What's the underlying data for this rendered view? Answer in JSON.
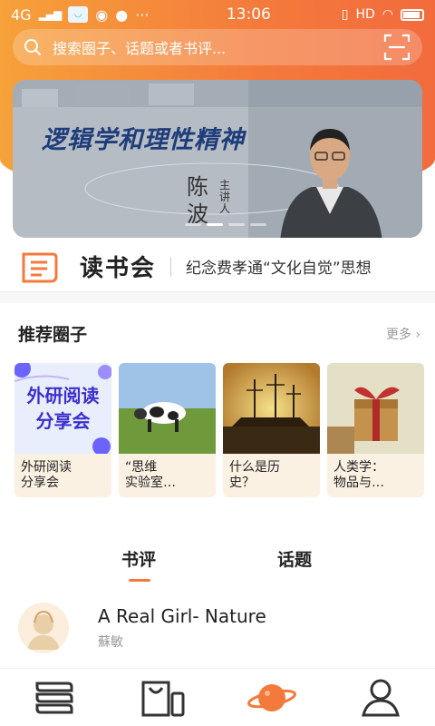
{
  "status": {
    "network": "4G",
    "time": "13:06",
    "hd": "HD"
  },
  "search": {
    "placeholder": "搜索圈子、话题或者书评..."
  },
  "banner": {
    "title": "逻辑学和理性精神",
    "name_line1": "陈",
    "name_line2": "波",
    "role": "主讲人"
  },
  "bookclub": {
    "name": "读书会",
    "headline": "纪念费孝通“文化自觉”思想"
  },
  "recommended": {
    "title": "推荐圈子",
    "more": "更多",
    "cards": [
      {
        "label_line1": "外研阅读",
        "label_line2": "分享会",
        "image_text_line1": "外研阅读",
        "image_text_line2": "分享会"
      },
      {
        "label_line1": "“思维",
        "label_line2": "实验室…"
      },
      {
        "label_line1": "什么是历",
        "label_line2": "史？"
      },
      {
        "label_line1": "人类学：",
        "label_line2": "物品与…"
      }
    ]
  },
  "tabs": {
    "review": "书评",
    "topic": "话题"
  },
  "review_item": {
    "title": "A Real Girl- Nature",
    "author": "蘇敏"
  },
  "colors": {
    "accent": "#f47a3c",
    "banner_title": "#1f3d7a"
  },
  "icons": {
    "search": "search-icon",
    "scan": "scan-icon",
    "nav": [
      "bookshelf-icon",
      "shop-icon",
      "planet-icon",
      "profile-icon"
    ]
  }
}
